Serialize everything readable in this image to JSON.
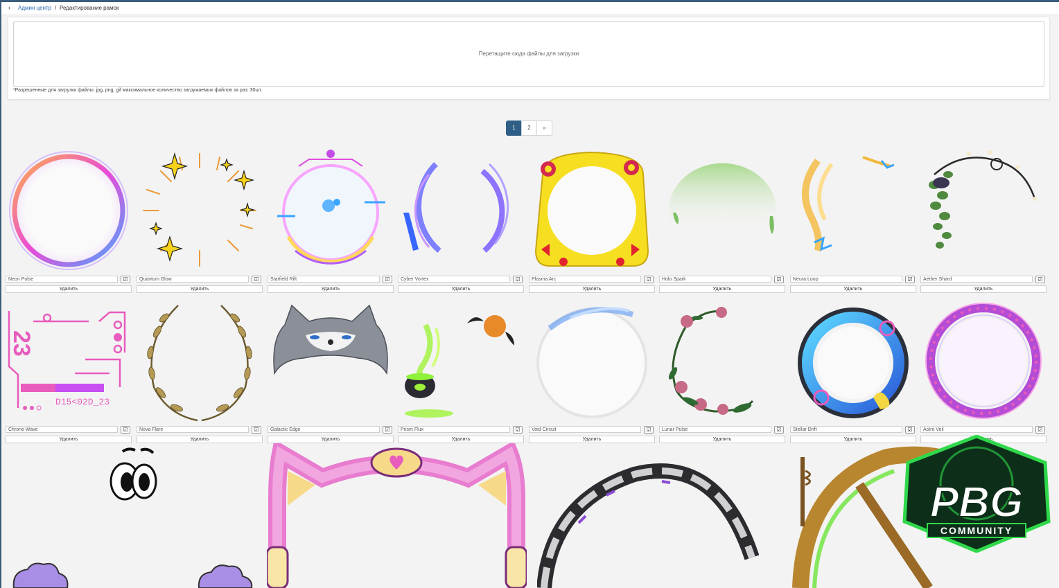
{
  "breadcrumb": {
    "link": "Админ центр",
    "separator": "/",
    "current": "Редактирование рамок"
  },
  "upload": {
    "dropzone_text": "Перетащите сюда файлы для загрузки",
    "note": "*Разрешенные для загрузки файлы: jpg, png, gif максимальное количество загружаемых файлов за раз: 30шт."
  },
  "pagination": {
    "pages": [
      "1",
      "2"
    ],
    "next": "»",
    "active": "1"
  },
  "frames": [
    {
      "name": "Neon Pulse",
      "delete_label": "Удалить"
    },
    {
      "name": "Quantum Glow",
      "delete_label": "Удалить"
    },
    {
      "name": "Starfield Rift",
      "delete_label": "Удалить"
    },
    {
      "name": "Cyber Vortex",
      "delete_label": "Удалить"
    },
    {
      "name": "Plasma Arc",
      "delete_label": "Удалить"
    },
    {
      "name": "Holo Spark",
      "delete_label": "Удалить"
    },
    {
      "name": "Neura Loop",
      "delete_label": "Удалить"
    },
    {
      "name": "Aether Shard",
      "delete_label": "Удалить"
    },
    {
      "name": "Chrono Wave",
      "delete_label": "Удалить"
    },
    {
      "name": "Nova Flare",
      "delete_label": "Удалить"
    },
    {
      "name": "Galactic Edge",
      "delete_label": "Удалить"
    },
    {
      "name": "Prism Flux",
      "delete_label": "Удалить"
    },
    {
      "name": "Void Circuit",
      "delete_label": "Удалить"
    },
    {
      "name": "Lunar Pulse",
      "delete_label": "Удалить"
    },
    {
      "name": "Stellar Drift",
      "delete_label": "Удалить"
    },
    {
      "name": "Astro Veil",
      "delete_label": "Удалить"
    }
  ],
  "frame1_text": {
    "number": "23",
    "code": "D15<02D_23"
  },
  "logo": {
    "main": "PBG",
    "sub": "COMMUNITY"
  },
  "icons": {
    "save": "edit-check-icon",
    "breadcrumb": "chevron-right-icon"
  }
}
